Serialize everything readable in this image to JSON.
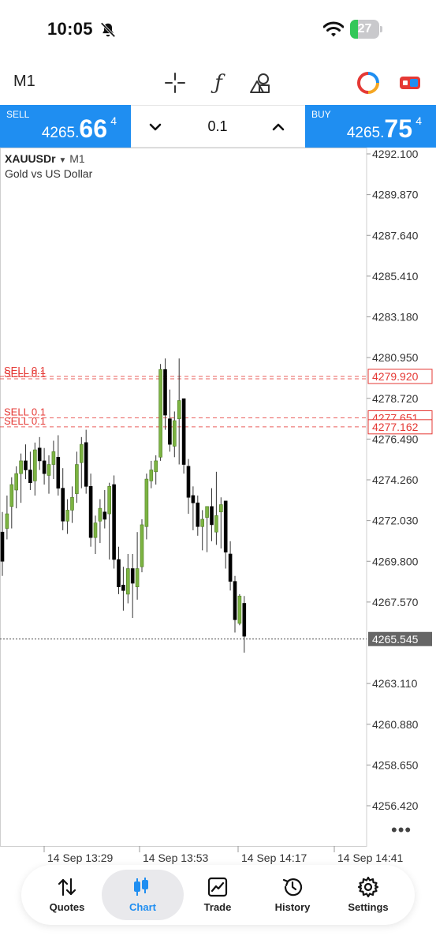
{
  "status_bar": {
    "time": "10:05",
    "battery": "27",
    "battery_level": 0.27,
    "battery_color": "#34c759"
  },
  "toolbar": {
    "timeframe": "M1",
    "icons": [
      "crosshair-icon",
      "indicators-icon",
      "objects-icon",
      "signals-icon",
      "one-click-trading-icon"
    ]
  },
  "trade": {
    "sell": {
      "label": "SELL",
      "price_small": "4265.",
      "price_big": "66",
      "price_sup": "4"
    },
    "buy": {
      "label": "BUY",
      "price_small": "4265.",
      "price_big": "75",
      "price_sup": "4"
    },
    "lot": "0.1",
    "accent": "#1f8ef1"
  },
  "chart": {
    "symbol": "XAUUSDr",
    "symbol_timeframe": "M1",
    "description": "Gold vs US Dollar",
    "colors": {
      "bull_candle": "#7cb342",
      "bear_candle": "#000000",
      "order_line": "#e53935",
      "bid_line": "#555555"
    }
  },
  "chart_data": {
    "type": "candlestick",
    "y_ticks": [
      "4292.100",
      "4289.870",
      "4287.640",
      "4285.410",
      "4283.180",
      "4280.950",
      "4278.720",
      "4276.490",
      "4274.260",
      "4272.030",
      "4269.800",
      "4267.570",
      "4265.545",
      "4263.110",
      "4260.880",
      "4258.650",
      "4256.420"
    ],
    "ylim": [
      4254.2,
      4293.0
    ],
    "x_ticks": [
      "14 Sep 13:29",
      "14 Sep 13:53",
      "14 Sep 14:17",
      "14 Sep 14:41"
    ],
    "current_price": "4265.545",
    "order_lines": [
      {
        "label": "SELL 0.1",
        "price": "4279.920"
      },
      {
        "label": "SELL 0.1",
        "price": "4279.920"
      },
      {
        "label": "SELL 0.1",
        "price": "4277.651"
      },
      {
        "label": "SELL 0.1",
        "price": "4277.162"
      }
    ],
    "candles": [
      [
        4271.4,
        4272.5,
        4269.0,
        4269.8
      ],
      [
        4271.6,
        4273.4,
        4271.0,
        4272.4
      ],
      [
        4272.8,
        4274.4,
        4271.6,
        4274.0
      ],
      [
        4273.7,
        4275.0,
        4272.7,
        4274.6
      ],
      [
        4274.6,
        4275.7,
        4273.0,
        4275.3
      ],
      [
        4275.3,
        4276.2,
        4274.3,
        4274.8
      ],
      [
        4274.8,
        4275.8,
        4273.7,
        4274.1
      ],
      [
        4274.2,
        4276.3,
        4273.4,
        4275.9
      ],
      [
        4276.0,
        4276.6,
        4274.8,
        4275.3
      ],
      [
        4275.3,
        4276.0,
        4274.0,
        4274.6
      ],
      [
        4274.5,
        4275.6,
        4273.5,
        4275.1
      ],
      [
        4275.1,
        4276.4,
        4274.3,
        4275.8
      ],
      [
        4275.5,
        4276.7,
        4273.4,
        4273.8
      ],
      [
        4273.8,
        4274.9,
        4271.5,
        4272.0
      ],
      [
        4272.0,
        4273.2,
        4271.3,
        4272.6
      ],
      [
        4272.6,
        4273.9,
        4271.9,
        4273.3
      ],
      [
        4273.5,
        4275.8,
        4273.0,
        4275.1
      ],
      [
        4275.2,
        4276.6,
        4273.8,
        4276.2
      ],
      [
        4276.3,
        4277.0,
        4273.5,
        4273.9
      ],
      [
        4273.9,
        4274.6,
        4270.6,
        4271.1
      ],
      [
        4271.1,
        4272.3,
        4270.2,
        4271.9
      ],
      [
        4272.0,
        4273.2,
        4270.8,
        4272.7
      ],
      [
        4272.5,
        4273.7,
        4271.6,
        4272.1
      ],
      [
        4272.4,
        4274.1,
        4269.9,
        4273.9
      ],
      [
        4274.0,
        4274.5,
        4269.4,
        4269.9
      ],
      [
        4269.9,
        4270.6,
        4268.0,
        4268.4
      ],
      [
        4268.5,
        4269.5,
        4267.1,
        4268.2
      ],
      [
        4268.0,
        4270.2,
        4267.5,
        4269.4
      ],
      [
        4269.4,
        4270.2,
        4266.7,
        4268.6
      ],
      [
        4268.4,
        4271.4,
        4267.7,
        4269.4
      ],
      [
        4269.5,
        4272.1,
        4269.2,
        4271.8
      ],
      [
        4271.7,
        4274.6,
        4271.0,
        4274.3
      ],
      [
        4274.2,
        4275.3,
        4273.8,
        4274.8
      ],
      [
        4274.7,
        4275.6,
        4274.0,
        4275.3
      ],
      [
        4275.5,
        4280.6,
        4275.3,
        4280.3
      ],
      [
        4280.3,
        4280.9,
        4277.0,
        4277.8
      ],
      [
        4277.6,
        4279.2,
        4275.8,
        4276.2
      ],
      [
        4276.1,
        4278.0,
        4275.5,
        4277.5
      ],
      [
        4277.6,
        4280.9,
        4275.1,
        4278.6
      ],
      [
        4278.7,
        4278.7,
        4274.6,
        4275.1
      ],
      [
        4275.0,
        4275.4,
        4272.4,
        4273.3
      ],
      [
        4273.4,
        4273.9,
        4271.5,
        4273.0
      ],
      [
        4273.0,
        4273.4,
        4271.2,
        4271.7
      ],
      [
        4271.7,
        4272.6,
        4270.4,
        4272.1
      ],
      [
        4272.2,
        4272.6,
        4270.3,
        4272.8
      ],
      [
        4272.8,
        4273.8,
        4270.9,
        4271.8
      ],
      [
        4271.4,
        4274.7,
        4270.7,
        4272.3
      ],
      [
        4272.5,
        4273.3,
        4270.5,
        4272.9
      ],
      [
        4273.1,
        4273.1,
        4269.4,
        4270.3
      ],
      [
        4270.2,
        4270.9,
        4268.2,
        4268.7
      ],
      [
        4268.7,
        4269.0,
        4265.9,
        4266.6
      ],
      [
        4266.4,
        4268.0,
        4266.3,
        4267.9
      ],
      [
        4267.5,
        4267.9,
        4264.8,
        4265.7
      ]
    ]
  },
  "nav": {
    "items": [
      {
        "label": "Quotes",
        "icon": "quotes-icon"
      },
      {
        "label": "Chart",
        "icon": "chart-icon",
        "active": true
      },
      {
        "label": "Trade",
        "icon": "trade-icon"
      },
      {
        "label": "History",
        "icon": "history-icon"
      },
      {
        "label": "Settings",
        "icon": "settings-icon"
      }
    ]
  }
}
